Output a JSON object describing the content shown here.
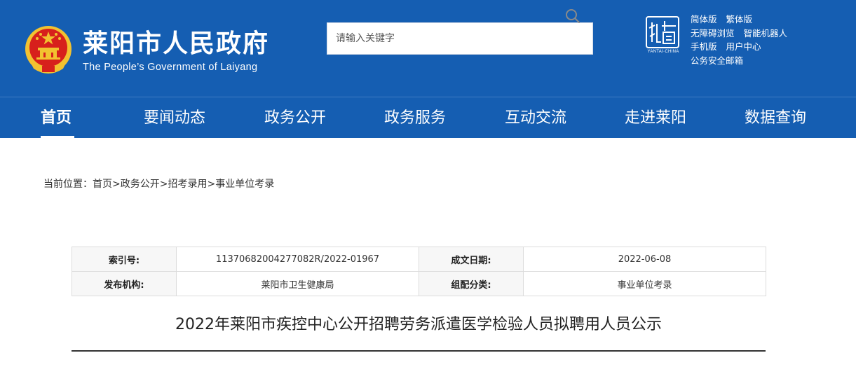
{
  "header": {
    "title": "莱阳市人民政府",
    "subtitle": "The People’s Government of Laiyang",
    "search_placeholder": "请输入关键字",
    "city_logo_caption": "YANTAI·CHINA",
    "links": [
      [
        "简体版",
        "繁体版"
      ],
      [
        "无障碍浏览",
        "智能机器人"
      ],
      [
        "手机版",
        "用户中心"
      ],
      [
        "公务安全邮箱"
      ]
    ]
  },
  "nav": {
    "items": [
      "首页",
      "要闻动态",
      "政务公开",
      "政务服务",
      "互动交流",
      "走进莱阳",
      "数据查询"
    ],
    "active_index": 0
  },
  "breadcrumb": {
    "prefix": "当前位置：",
    "items": [
      "首页",
      "政务公开",
      "招考录用",
      "事业单位考录"
    ],
    "separator": ">"
  },
  "info": {
    "index_label": "索引号:",
    "index_value": "11370682004277082R/2022-01967",
    "date_label": "成文日期:",
    "date_value": "2022-06-08",
    "publisher_label": "发布机构:",
    "publisher_value": "莱阳市卫生健康局",
    "category_label": "组配分类:",
    "category_value": "事业单位考录"
  },
  "article": {
    "title": "2022年莱阳市疾控中心公开招聘劳务派遣医学检验人员拟聘用人员公示"
  },
  "colors": {
    "header_blue": "#155eb2",
    "emblem_red": "#d7201c",
    "emblem_gold": "#f2c230"
  }
}
